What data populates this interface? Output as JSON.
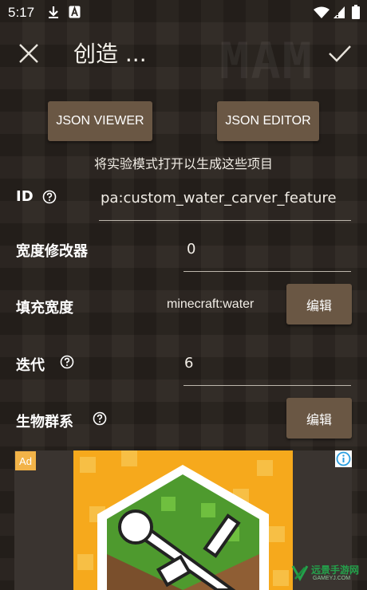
{
  "status_bar": {
    "time": "5:17",
    "left_icons": [
      "download-icon",
      "text-a-icon"
    ],
    "right_icons": [
      "wifi-icon",
      "sim-blocked-icon",
      "battery-icon"
    ]
  },
  "app_bar": {
    "title": "创造 ...",
    "watermark": "MAM",
    "close_icon": "close-icon",
    "confirm_icon": "check-icon"
  },
  "actions": {
    "json_viewer_label": "JSON VIEWER",
    "json_editor_label": "JSON EDITOR",
    "hint": "将实验模式打开以生成这些项目"
  },
  "form": {
    "id": {
      "label": "ID",
      "value": "pa:custom_water_carver_feature"
    },
    "width_modifier": {
      "label": "宽度修改器",
      "value": "0"
    },
    "fill_width": {
      "label": "填充宽度",
      "value": "minecraft:water",
      "button": "编辑"
    },
    "iterations": {
      "label": "迭代",
      "value": "6"
    },
    "biomes": {
      "label": "生物群系",
      "button": "编辑"
    }
  },
  "ad": {
    "badge": "Ad",
    "info_icon": "info-icon"
  },
  "branding": {
    "name": "远景手游网",
    "sub": "GAMEYJ.COM"
  },
  "colors": {
    "background": "#2b2520",
    "button": "#6a5744",
    "ad_badge": "#f2b348",
    "ad_info": "#2a9ee0",
    "brand_green": "#24a14b"
  }
}
